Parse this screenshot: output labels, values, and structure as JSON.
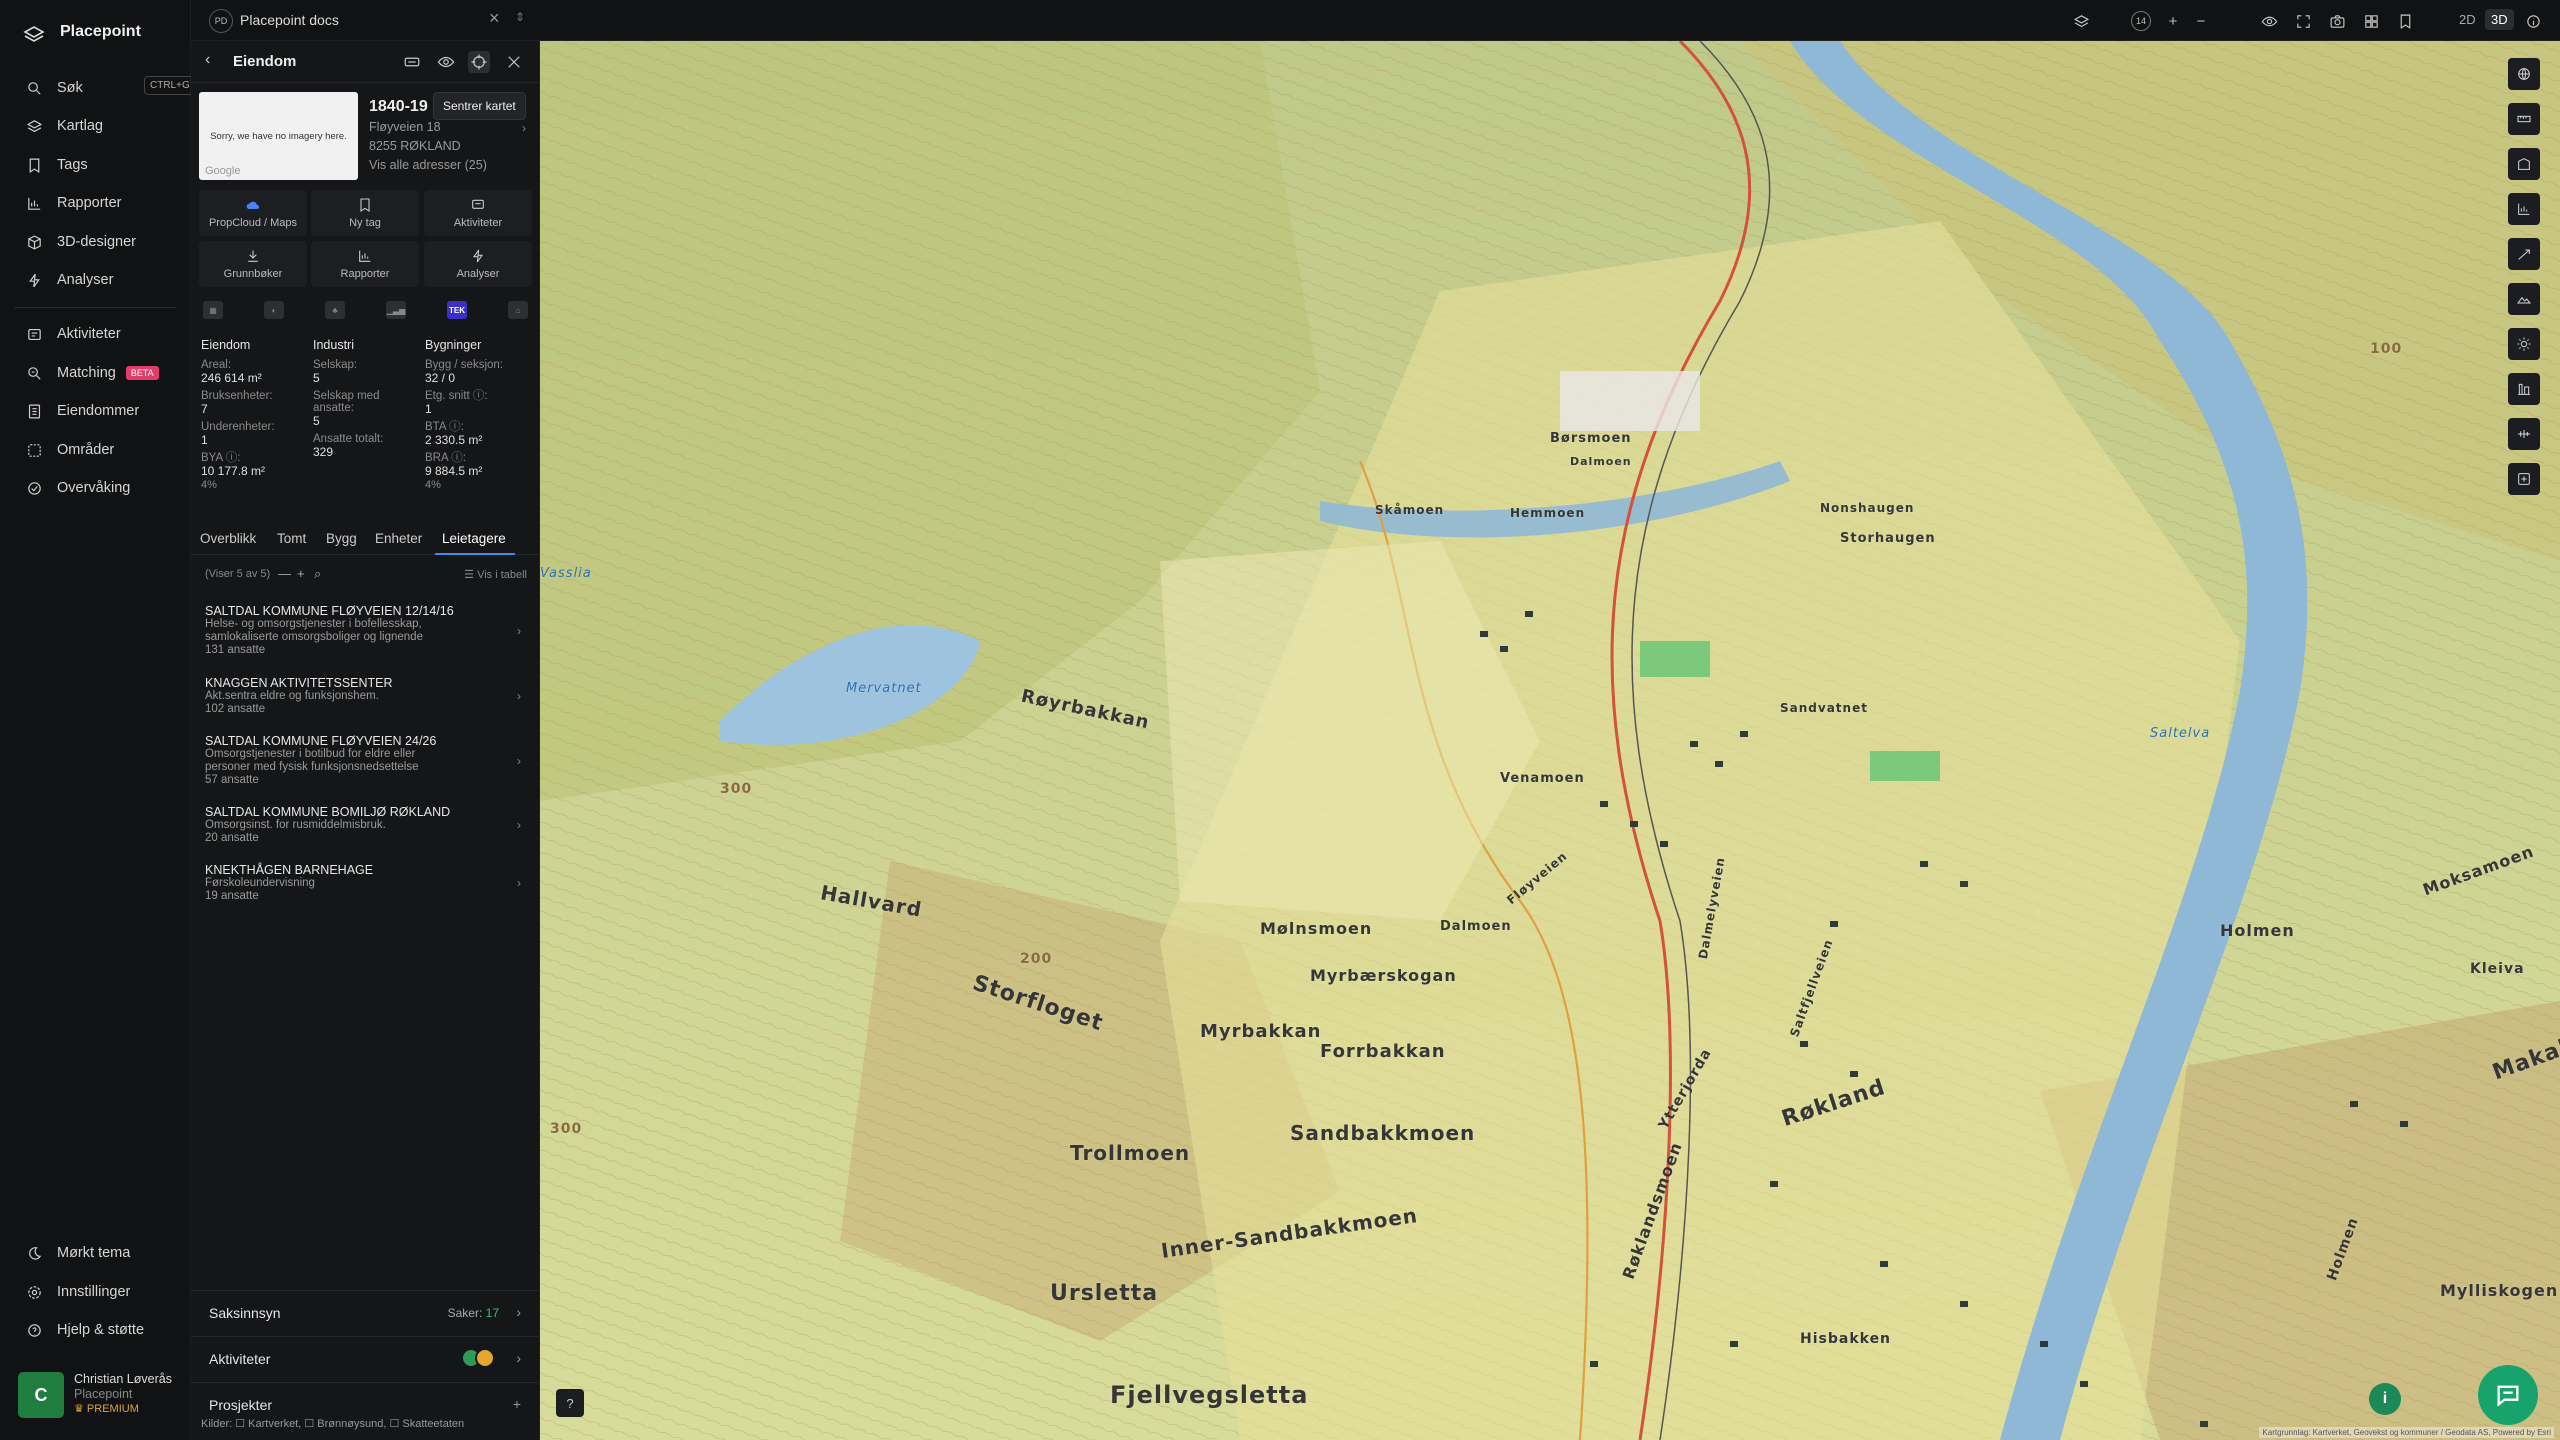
{
  "app": {
    "name": "Placepoint"
  },
  "nav": {
    "top": [
      {
        "label": "Søk",
        "shortcut": "CTRL+G",
        "icon": "search-icon"
      },
      {
        "label": "Kartlag",
        "icon": "layers-icon"
      },
      {
        "label": "Tags",
        "icon": "bookmark-icon"
      },
      {
        "label": "Rapporter",
        "icon": "chart-icon"
      },
      {
        "label": "3D-designer",
        "icon": "cube-icon"
      },
      {
        "label": "Analyser",
        "icon": "bolt-icon"
      }
    ],
    "middle": [
      {
        "label": "Aktiviteter",
        "icon": "activity-icon"
      },
      {
        "label": "Matching",
        "badge": "BETA",
        "icon": "match-icon"
      },
      {
        "label": "Eiendommer",
        "icon": "building-icon"
      },
      {
        "label": "Områder",
        "icon": "area-icon"
      },
      {
        "label": "Overvåking",
        "icon": "monitor-icon"
      }
    ],
    "bottom": [
      {
        "label": "Mørkt tema",
        "icon": "moon-icon"
      },
      {
        "label": "Innstillinger",
        "icon": "gear-icon"
      },
      {
        "label": "Hjelp & støtte",
        "icon": "help-icon"
      }
    ],
    "user": {
      "initial": "C",
      "name": "Christian Løverås",
      "org": "Placepoint",
      "plan": "PREMIUM"
    }
  },
  "topbar": {
    "workspace_badge": "PD",
    "workspace_title": "Placepoint docs",
    "mode_2d": "2D",
    "mode_3d": "3D",
    "active_mode": "3D",
    "zoom_level": "14"
  },
  "panel": {
    "title": "Eiendom",
    "tooltip": "Sentrer kartet",
    "thumb_text": "Sorry, we have no imagery here.",
    "thumb_logo": "Google",
    "property_id": "1840-19",
    "address_line1": "Fløyveien 18",
    "address_line2": "8255 RØKLAND",
    "all_addresses": "Vis alle adresser (25)",
    "actions": [
      {
        "label": "PropCloud / Maps",
        "icon": "propcloud-icon"
      },
      {
        "label": "Ny tag",
        "icon": "tag-icon"
      },
      {
        "label": "Aktiviteter",
        "icon": "activity-icon"
      },
      {
        "label": "Grunnbøker",
        "icon": "download-icon"
      },
      {
        "label": "Rapporter",
        "icon": "chart-icon"
      },
      {
        "label": "Analyser",
        "icon": "bolt-icon"
      }
    ],
    "stats": {
      "eiendom": {
        "head": "Eiendom",
        "areal_lbl": "Areal:",
        "areal_val": "246 614 m²",
        "bruk_lbl": "Bruksenheter:",
        "bruk_val": "7",
        "under_lbl": "Underenheter:",
        "under_val": "1",
        "bya_lbl": "BYA ⓘ:",
        "bya_val": "10 177.8 m²",
        "bya_pct": "4%"
      },
      "industri": {
        "head": "Industri",
        "selskap_lbl": "Selskap:",
        "selskap_val": "5",
        "selskap_ans_lbl": "Selskap med ansatte:",
        "selskap_ans_val": "5",
        "ans_tot_lbl": "Ansatte totalt:",
        "ans_tot_val": "329"
      },
      "bygninger": {
        "head": "Bygninger",
        "bygg_lbl": "Bygg / seksjon:",
        "bygg_val": "32 / 0",
        "etg_lbl": "Etg. snitt ⓘ:",
        "etg_val": "1",
        "bta_lbl": "BTA ⓘ:",
        "bta_val": "2 330.5 m²",
        "bra_lbl": "BRA ⓘ:",
        "bra_val": "9 884.5 m²",
        "bra_pct": "4%"
      }
    },
    "tabs": [
      "Overblikk",
      "Tomt",
      "Bygg",
      "Enheter",
      "Leietagere"
    ],
    "active_tab": "Leietagere",
    "list_count": "(Viser 5 av 5)",
    "list_table": "Vis i tabell",
    "tenants": [
      {
        "name": "SALTDAL KOMMUNE FLØYVEIEN 12/14/16",
        "desc1": "Helse- og omsorgstjenester i bofellesskap,",
        "desc2": "samlokaliserte omsorgsboliger og lignende",
        "employees": "131 ansatte"
      },
      {
        "name": "KNAGGEN AKTIVITETSSENTER",
        "desc1": "Akt.sentra eldre og funksjonshem.",
        "desc2": "",
        "employees": "102 ansatte"
      },
      {
        "name": "SALTDAL KOMMUNE FLØYVEIEN 24/26",
        "desc1": "Omsorgstjenester i botilbud for eldre eller",
        "desc2": "personer med fysisk funksjonsnedsettelse",
        "employees": "57 ansatte"
      },
      {
        "name": "SALTDAL KOMMUNE BOMILJØ RØKLAND",
        "desc1": "Omsorgsinst. for rusmiddelmisbruk.",
        "desc2": "",
        "employees": "20 ansatte"
      },
      {
        "name": "KNEKTHÅGEN BARNEHAGE",
        "desc1": "Førskoleundervisning",
        "desc2": "",
        "employees": "19 ansatte"
      }
    ],
    "sections": {
      "saksinnsyn": {
        "label": "Saksinnsyn",
        "saker_lbl": "Saker:",
        "saker_cnt": "17"
      },
      "aktiviteter": {
        "label": "Aktiviteter"
      },
      "prosjekter": {
        "label": "Prosjekter"
      }
    },
    "sources": "Kilder: ☐ Kartverket, ☐ Brønnøysund, ☐ Skatteetaten"
  },
  "map": {
    "places": [
      "Børsmoen",
      "Dalmoen",
      "Skåmoen",
      "Hemmoen",
      "Nonshaugen",
      "Storhaugen",
      "Røyrbakkan",
      "Hallvard",
      "Storfloget",
      "Venamoen",
      "Fløyveien",
      "Dalmoen",
      "Mølnsmoen",
      "Myrbærskogan",
      "Myrbakkan",
      "Forrbakkan",
      "Trollmoen",
      "Sandbakkmoen",
      "Inner-Sandbakkmoen",
      "Ursletta",
      "Røkland",
      "Saltfjellveien",
      "Holmen",
      "Røklandsmoen",
      "Fjellvegsletta",
      "Mylliskogen",
      "Kleiva",
      "Hisbakken",
      "Ytterjorda",
      "Holmen",
      "Dalmelyveien",
      "Sandvatnet",
      "Moksamoen",
      "Makalmo"
    ],
    "water_labels": [
      "Mervatnet",
      "Vasslia",
      "Saltelva"
    ],
    "contours": [
      "300",
      "200",
      "300",
      "100"
    ],
    "attribution": "Kartgrunnlag: Kartverket, Geovekst og kommuner / Geodata AS, Powered by Esri"
  },
  "colors": {
    "accent": "#3b8ef0",
    "brand_green": "#18a36d",
    "beta": "#e23d6a"
  }
}
